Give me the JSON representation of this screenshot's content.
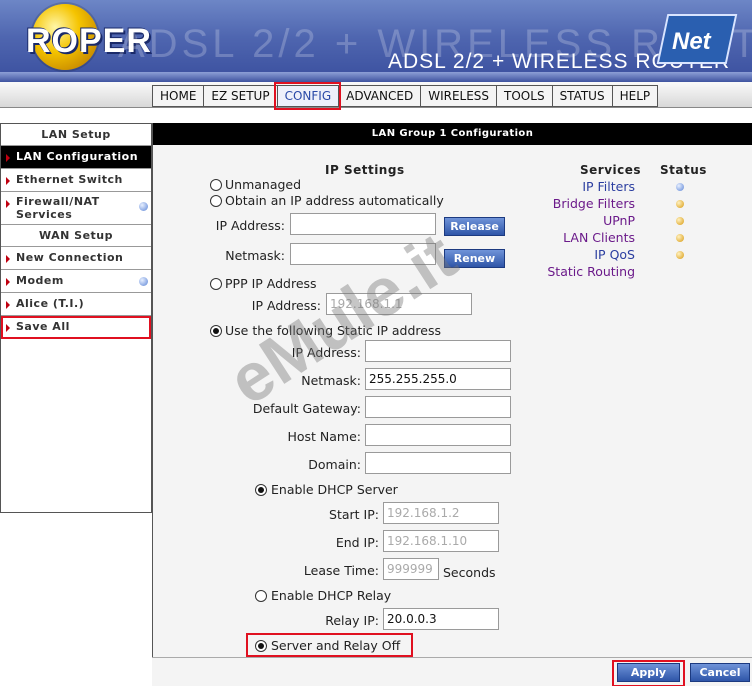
{
  "header": {
    "brand": "ROPER",
    "ghost_title": "ADSL 2/2 + WIRELESS ROUTER",
    "product": "ADSL 2/2 + WIRELESS ROUTER",
    "logo_text": "Net"
  },
  "nav": {
    "tabs": [
      "HOME",
      "EZ SETUP",
      "CONFIG",
      "ADVANCED",
      "WIRELESS",
      "TOOLS",
      "STATUS",
      "HELP"
    ],
    "active": "CONFIG"
  },
  "sidebar": {
    "lan_header": "LAN Setup",
    "lan_items": [
      "LAN Configuration",
      "Ethernet Switch",
      "Firewall/NAT Services"
    ],
    "wan_header": "WAN Setup",
    "wan_items": [
      "New Connection",
      "Modem",
      "Alice (T.I.)",
      "Save All"
    ]
  },
  "main": {
    "title": "LAN Group 1 Configuration",
    "ip_settings_header": "IP Settings",
    "unmanaged": "Unmanaged",
    "obtain_auto": "Obtain an IP address automatically",
    "ip_address_label": "IP Address:",
    "netmask_label": "Netmask:",
    "release_button": "Release",
    "renew_button": "Renew",
    "ppp_ip": "PPP IP Address",
    "ppp_ip_value": "192.168.1.1",
    "static_ip": "Use the following Static IP address",
    "static": {
      "ip_address_label": "IP Address:",
      "ip_address_value": "",
      "netmask_label": "Netmask:",
      "netmask_value": "255.255.255.0",
      "gateway_label": "Default Gateway:",
      "hostname_label": "Host Name:",
      "domain_label": "Domain:"
    },
    "dhcp_server": "Enable DHCP Server",
    "start_ip_label": "Start IP:",
    "start_ip_value": "192.168.1.2",
    "end_ip_label": "End IP:",
    "end_ip_value": "192.168.1.10",
    "lease_label": "Lease Time:",
    "lease_value": "999999",
    "lease_unit": "Seconds",
    "dhcp_relay": "Enable DHCP Relay",
    "relay_ip_label": "Relay IP:",
    "relay_ip_value": "20.0.0.3",
    "server_relay_off": "Server and Relay Off",
    "services_header": "Services",
    "status_header": "Status",
    "services": [
      "IP Filters",
      "Bridge Filters",
      "UPnP",
      "LAN Clients",
      "IP QoS",
      "Static Routing"
    ],
    "service_status": [
      "blue",
      "amber",
      "amber",
      "amber",
      "amber",
      ""
    ]
  },
  "footer": {
    "apply_label": "Apply",
    "cancel_label": "Cancel"
  },
  "watermark": "eMule.it",
  "colors": {
    "highlight": "#e01020",
    "button_blue": "#2e55a8",
    "link_blue": "#2b3ea0"
  }
}
